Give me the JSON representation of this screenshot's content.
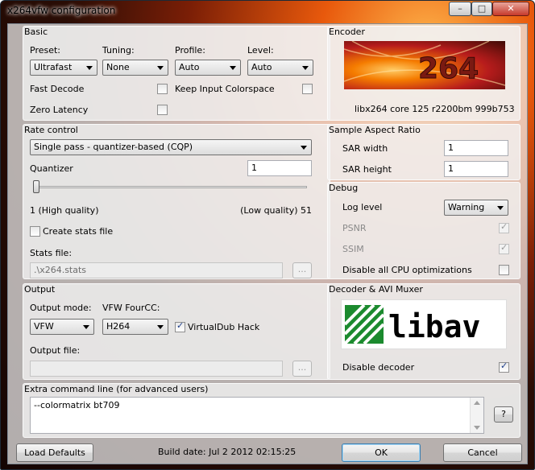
{
  "window": {
    "title": "x264vfw configuration",
    "min": "–",
    "max": "□",
    "close": "✕"
  },
  "basic": {
    "title": "Basic",
    "preset_label": "Preset:",
    "preset_value": "Ultrafast",
    "tuning_label": "Tuning:",
    "tuning_value": "None",
    "profile_label": "Profile:",
    "profile_value": "Auto",
    "level_label": "Level:",
    "level_value": "Auto",
    "fast_decode": "Fast Decode",
    "keep_colorspace": "Keep Input Colorspace",
    "zero_latency": "Zero Latency"
  },
  "encoder": {
    "title": "Encoder",
    "logo_text": "264",
    "version": "libx264 core 125 r2200bm 999b753"
  },
  "rate_control": {
    "title": "Rate control",
    "mode": "Single pass - quantizer-based (CQP)",
    "quantizer_label": "Quantizer",
    "quantizer_value": "1",
    "quantizer_min": 1,
    "quantizer_max": 51,
    "min_label": "1 (High quality)",
    "max_label": "(Low quality) 51",
    "create_stats": "Create stats file",
    "stats_label": "Stats file:",
    "stats_value": ".\\x264.stats",
    "browse": "..."
  },
  "sar": {
    "title": "Sample Aspect Ratio",
    "width_label": "SAR width",
    "width_value": "1",
    "height_label": "SAR height",
    "height_value": "1"
  },
  "debug": {
    "title": "Debug",
    "log_label": "Log level",
    "log_value": "Warning",
    "psnr": "PSNR",
    "ssim": "SSIM",
    "disable_cpu": "Disable all CPU optimizations"
  },
  "output": {
    "title": "Output",
    "mode_label": "Output mode:",
    "mode_value": "VFW",
    "fourcc_label": "VFW FourCC:",
    "fourcc_value": "H264",
    "vdub_hack": "VirtualDub Hack",
    "file_label": "Output file:",
    "file_value": "",
    "browse": "..."
  },
  "decoder": {
    "title": "Decoder & AVI Muxer",
    "logo_text": "libav",
    "disable_decoder": "Disable decoder"
  },
  "extra": {
    "title": "Extra command line (for advanced users)",
    "value": "--colormatrix bt709",
    "help": "?"
  },
  "footer": {
    "load_defaults": "Load Defaults",
    "build_date": "Build date: Jul  2 2012 02:15:25",
    "ok": "OK",
    "cancel": "Cancel"
  }
}
